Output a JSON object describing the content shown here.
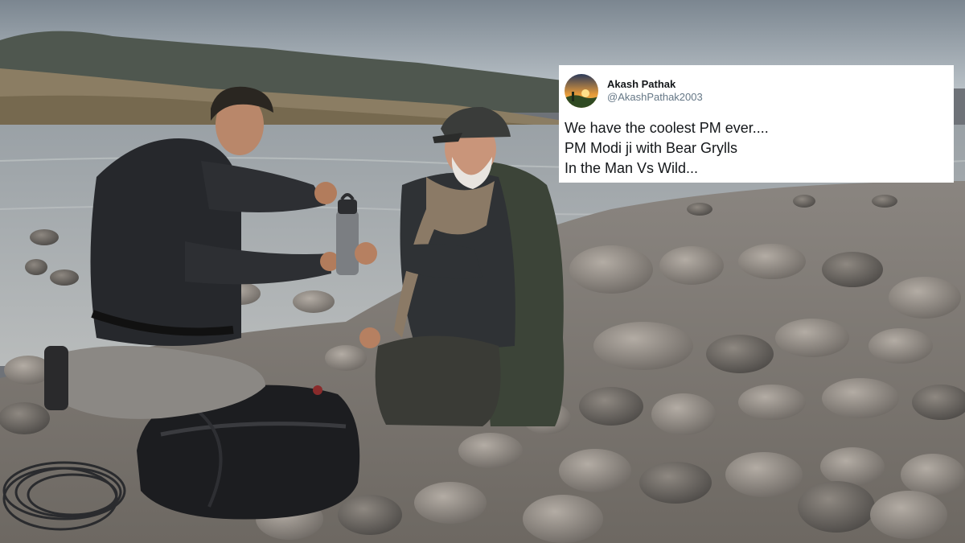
{
  "photo": {
    "scene": "riverbank-two-men-sharing-water-bottle"
  },
  "tweet": {
    "author": {
      "name": "Akash Pathak",
      "handle": "@AkashPathak2003",
      "avatar_icon": "sunset-avatar"
    },
    "lines": [
      "We have the coolest PM ever....",
      "PM Modi ji with Bear Grylls",
      "In the Man Vs Wild..."
    ]
  },
  "colors": {
    "card_background": "#ffffff",
    "name_color": "#14171a",
    "handle_color": "#657786"
  }
}
